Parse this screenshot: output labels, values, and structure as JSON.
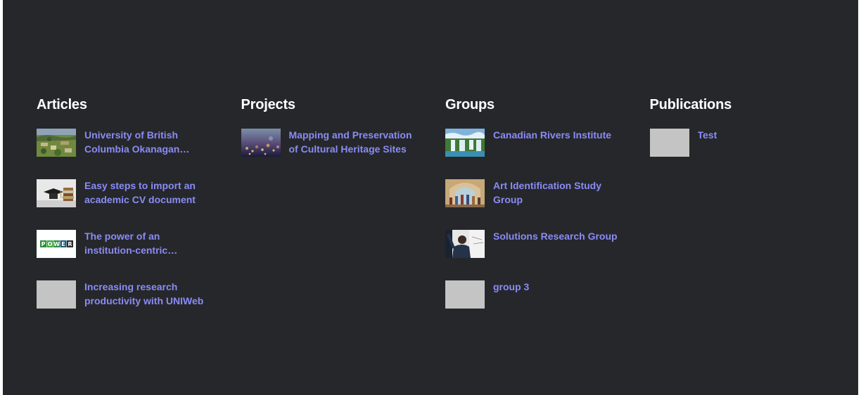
{
  "colors": {
    "background": "#26272b",
    "heading": "#ffffff",
    "link": "#8a8cf4",
    "placeholder_thumb": "#c4c4c4"
  },
  "columns": [
    {
      "title": "Articles",
      "items": [
        {
          "label": "University of British Columbia Okanagan Campus",
          "thumb": "campus-aerial-photo"
        },
        {
          "label": "Easy steps to import an academic CV document",
          "thumb": "graduation-cap-books-photo"
        },
        {
          "label": "The power of an institution-centric research platform",
          "thumb": "power-logo"
        },
        {
          "label": "Increasing research productivity with UNIWeb",
          "thumb": "placeholder"
        }
      ]
    },
    {
      "title": "Projects",
      "items": [
        {
          "label": "Mapping and Preservation of Cultural Heritage Sites",
          "thumb": "city-lights-photo"
        }
      ]
    },
    {
      "title": "Groups",
      "items": [
        {
          "label": "Canadian Rivers Institute",
          "thumb": "waterfall-photo"
        },
        {
          "label": "Art Identification Study Group",
          "thumb": "classical-painting-photo"
        },
        {
          "label": "Solutions Research Group",
          "thumb": "person-whiteboard-photo"
        },
        {
          "label": "group 3",
          "thumb": "placeholder"
        }
      ]
    },
    {
      "title": "Publications",
      "items": [
        {
          "label": "Test",
          "thumb": "placeholder"
        }
      ]
    }
  ],
  "power_logo_letters": [
    "P",
    "O",
    "W",
    "E",
    "R"
  ]
}
